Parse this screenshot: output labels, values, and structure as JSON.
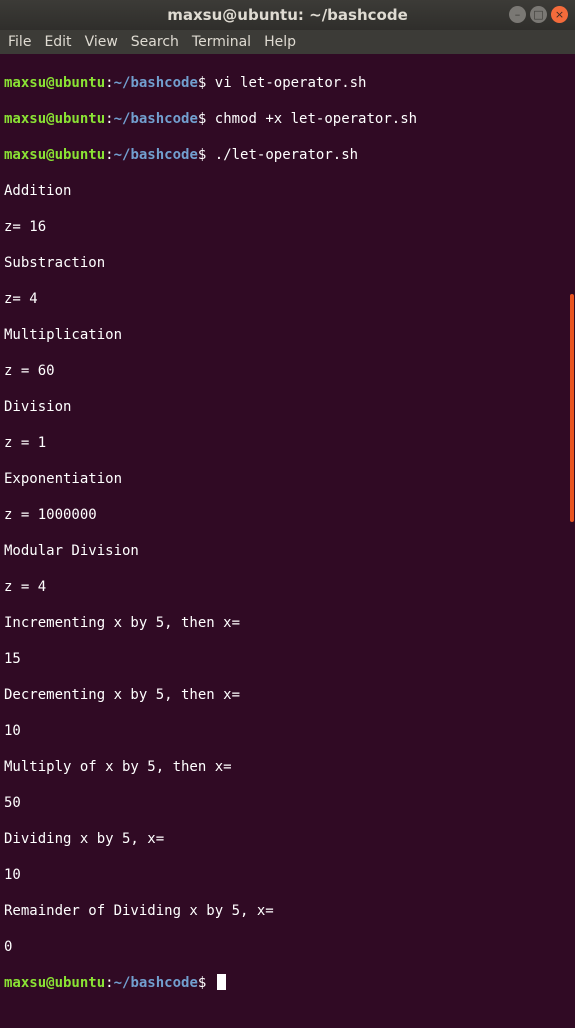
{
  "window": {
    "title": "maxsu@ubuntu: ~/bashcode"
  },
  "menubar": {
    "items": [
      "File",
      "Edit",
      "View",
      "Search",
      "Terminal",
      "Help"
    ]
  },
  "prompt": {
    "user": "maxsu@ubuntu",
    "sep": ":",
    "path": "~/bashcode",
    "sign": "$"
  },
  "commands": [
    "vi let-operator.sh",
    "chmod +x let-operator.sh",
    "./let-operator.sh"
  ],
  "output": [
    "Addition",
    "z= 16",
    "Substraction",
    "z= 4",
    "Multiplication",
    "z = 60",
    "Division",
    "z = 1",
    "Exponentiation",
    "z = 1000000",
    "Modular Division",
    "z = 4",
    "Incrementing x by 5, then x=",
    "15",
    "Decrementing x by 5, then x=",
    "10",
    "Multiply of x by 5, then x=",
    "50",
    "Dividing x by 5, x=",
    "10",
    "Remainder of Dividing x by 5, x=",
    "0"
  ],
  "colors": {
    "background": "#300a24",
    "prompt_user": "#8ae234",
    "prompt_path": "#729fcf",
    "scrollbar": "#e95420"
  }
}
